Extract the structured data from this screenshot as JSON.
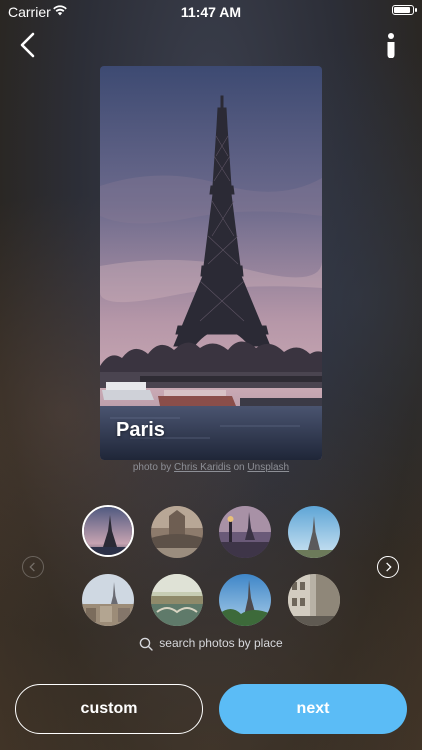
{
  "status_bar": {
    "carrier": "Carrier",
    "time": "11:47 AM"
  },
  "header": {
    "back_icon": "chevron-left-icon",
    "info_icon": "info-icon"
  },
  "photo": {
    "city_name": "Paris"
  },
  "credit": {
    "prefix": "photo by",
    "author": "Chris Karidis",
    "middle": "on",
    "source": "Unsplash"
  },
  "thumbnails": [
    {
      "name": "eiffel-tower-dusk",
      "selected": true
    },
    {
      "name": "notre-dame-bridge",
      "selected": false
    },
    {
      "name": "bridge-lamps-eiffel",
      "selected": false
    },
    {
      "name": "eiffel-tower-blue-sky",
      "selected": false
    },
    {
      "name": "paris-rooftops",
      "selected": false
    },
    {
      "name": "seine-river-bridge",
      "selected": false
    },
    {
      "name": "eiffel-tower-trees",
      "selected": false
    },
    {
      "name": "paris-street",
      "selected": false
    }
  ],
  "search": {
    "label": "search photos by place"
  },
  "buttons": {
    "custom": "custom",
    "next": "next"
  },
  "colors": {
    "accent": "#5bbcf6"
  }
}
